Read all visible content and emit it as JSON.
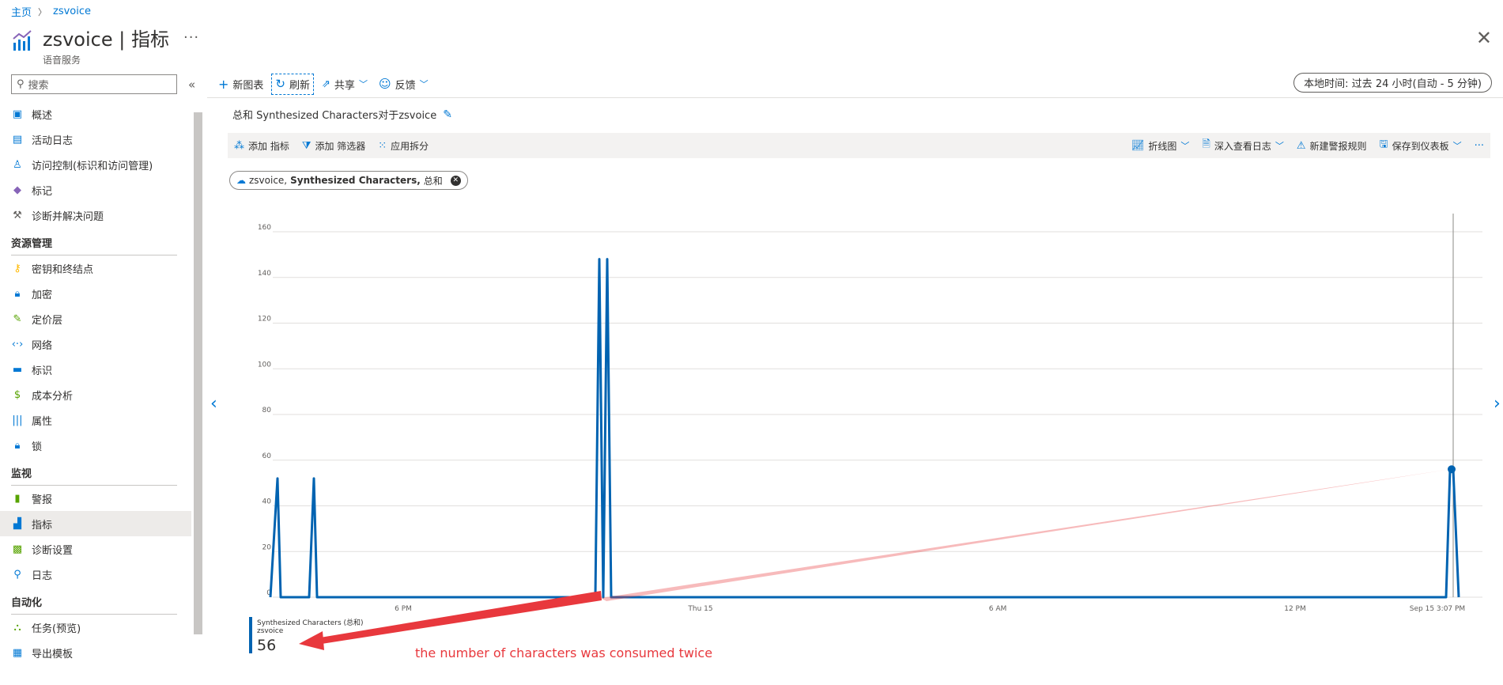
{
  "breadcrumb": {
    "home": "主页",
    "resource": "zsvoice"
  },
  "header": {
    "title": "zsvoice | 指标",
    "subtitle": "语音服务",
    "more": "···",
    "close": "✕"
  },
  "sidebar": {
    "search_placeholder": "搜索",
    "collapse": "«",
    "items_top": [
      {
        "label": "概述",
        "icon": "overview-icon",
        "glyph": "▣",
        "color": "#0078d4"
      },
      {
        "label": "活动日志",
        "icon": "activity-log-icon",
        "glyph": "▤",
        "color": "#0078d4"
      },
      {
        "label": "访问控制(标识和访问管理)",
        "icon": "access-control-icon",
        "glyph": "♙",
        "color": "#0078d4"
      },
      {
        "label": "标记",
        "icon": "tag-icon",
        "glyph": "◆",
        "color": "#8764b8"
      },
      {
        "label": "诊断并解决问题",
        "icon": "wrench-icon",
        "glyph": "⚒",
        "color": "#605e5c"
      }
    ],
    "section_resource": "资源管理",
    "items_resource": [
      {
        "label": "密钥和终结点",
        "icon": "key-icon",
        "glyph": "⚷",
        "color": "#ffb900"
      },
      {
        "label": "加密",
        "icon": "lock-icon",
        "glyph": "🔒︎",
        "color": "#0078d4"
      },
      {
        "label": "定价层",
        "icon": "pricing-tier-icon",
        "glyph": "✎",
        "color": "#57a300"
      },
      {
        "label": "网络",
        "icon": "network-icon",
        "glyph": "‹·›",
        "color": "#0078d4"
      },
      {
        "label": "标识",
        "icon": "identity-icon",
        "glyph": "▬",
        "color": "#0078d4"
      },
      {
        "label": "成本分析",
        "icon": "cost-analysis-icon",
        "glyph": "$",
        "color": "#57a300"
      },
      {
        "label": "属性",
        "icon": "properties-icon",
        "glyph": "|||",
        "color": "#0078d4"
      },
      {
        "label": "锁",
        "icon": "lock-icon",
        "glyph": "🔒︎",
        "color": "#0078d4"
      }
    ],
    "section_monitor": "监视",
    "items_monitor": [
      {
        "label": "警报",
        "icon": "alerts-icon",
        "glyph": "▮",
        "color": "#57a300"
      },
      {
        "label": "指标",
        "icon": "metrics-icon",
        "glyph": "▟",
        "color": "#0078d4",
        "active": true
      },
      {
        "label": "诊断设置",
        "icon": "diagnostic-settings-icon",
        "glyph": "▩",
        "color": "#57a300"
      },
      {
        "label": "日志",
        "icon": "logs-icon",
        "glyph": "⚲",
        "color": "#0078d4"
      }
    ],
    "section_automation": "自动化",
    "items_automation": [
      {
        "label": "任务(预览)",
        "icon": "tasks-icon",
        "glyph": "⛬",
        "color": "#57a300"
      },
      {
        "label": "导出模板",
        "icon": "export-template-icon",
        "glyph": "▦",
        "color": "#0078d4"
      }
    ]
  },
  "toolbar": {
    "new_chart": "新图表",
    "refresh": "刷新",
    "share": "共享",
    "feedback": "反馈",
    "time_range": "本地时间: 过去 24 小时(自动 - 5 分钟)"
  },
  "chart_title": "总和 Synthesized Characters对于zsvoice",
  "chart_toolbar": {
    "add_metric": "添加 指标",
    "add_filter": "添加 筛选器",
    "apply_split": "应用拆分",
    "line_chart": "折线图",
    "drill_logs": "深入查看日志",
    "new_alert": "新建警报规则",
    "save_dashboard": "保存到仪表板",
    "more": "···"
  },
  "metric_pill": {
    "resource": "zsvoice,",
    "metric": "Synthesized Characters,",
    "agg": "总和"
  },
  "legend": {
    "metric": "Synthesized Characters (总和)",
    "resource": "zsvoice",
    "value": "56"
  },
  "annotation": "the number of characters was consumed twice",
  "colors": {
    "accent": "#0078d4",
    "series": "#0063b1",
    "annotation": "#e8383d"
  },
  "chart_data": {
    "type": "line",
    "xlabel": "",
    "ylabel": "",
    "ylim": [
      0,
      160
    ],
    "yticks": [
      0,
      20,
      40,
      60,
      80,
      100,
      120,
      140,
      160
    ],
    "xtick_labels": [
      "6 PM",
      "Thu 15",
      "6 AM",
      "12 PM",
      "Sep 15 3:07 PM"
    ],
    "series": [
      {
        "values": [
          0,
          52,
          0,
          0,
          52,
          0,
          0,
          148,
          0,
          148,
          0,
          0,
          56,
          56,
          0
        ]
      }
    ],
    "highlight_value": 56
  }
}
